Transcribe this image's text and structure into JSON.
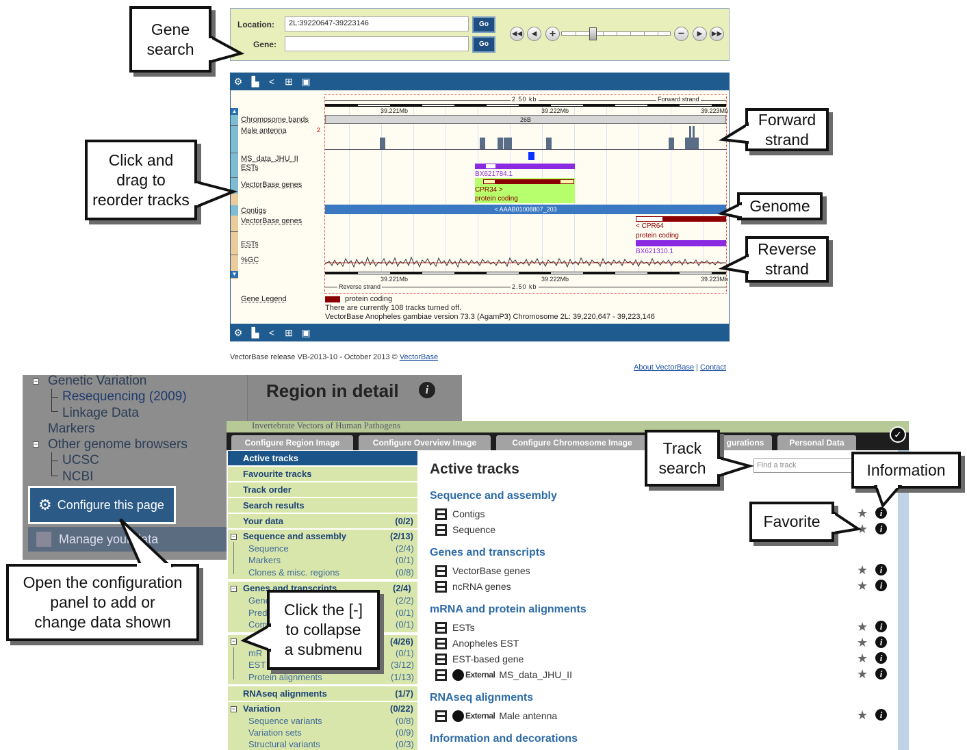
{
  "callouts": {
    "gene_search": "Gene\nsearch",
    "click_drag": "Click and\ndrag to\nreorder tracks",
    "forward_strand": "Forward\nstrand",
    "genome": "Genome",
    "reverse_strand": "Reverse\nstrand",
    "open_config": "Open the configuration\npanel to add or\nchange data shown",
    "collapse": "Click the [-]\nto collapse\na submenu",
    "track_search": "Track\nsearch",
    "information": "Information",
    "favorite": "Favorite"
  },
  "search": {
    "location_label": "Location:",
    "location_value": "2L:39220647-39223146",
    "gene_label": "Gene:",
    "gene_value": "",
    "go_label": "Go",
    "nav_icons": [
      "rewind-icon",
      "step-back-icon",
      "zoom-in-icon",
      "zoom-out-icon",
      "step-forward-icon",
      "fast-forward-icon"
    ]
  },
  "region": {
    "scale_label": "2.50 kb",
    "forward_strand_label": "Forward strand",
    "reverse_strand_label": "Reverse strand",
    "ticks": [
      "39.221Mb",
      "39.222Mb",
      "39.223Mb"
    ],
    "band_label": "26B",
    "male_antenna_count": "2",
    "tracks": {
      "chromosome_bands": "Chromosome bands",
      "male_antenna": "Male antenna",
      "ms_data": "MS_data_JHU_II",
      "ests_fwd": "ESTs",
      "genes_fwd": "VectorBase genes",
      "contigs": "Contigs",
      "genes_rev": "VectorBase genes",
      "ests_rev": "ESTs",
      "gc": "%GC",
      "legend": "Gene Legend"
    },
    "features": {
      "est_fwd": "BX621784.1",
      "gene_fwd_name": "CPR34 >",
      "gene_fwd_type": "protein coding",
      "contig": "< AAAB01008807_203",
      "gene_rev_name": "< CPR64",
      "gene_rev_type": "protein coding",
      "est_rev": "BX621310.1"
    },
    "legend_item": "protein coding",
    "note_tracks_off": "There are currently 108 tracks turned off.",
    "note_version": "VectorBase Anopheles gambiae version 73.3 (AgamP3) Chromosome 2L: 39,220,647 - 39,223,146",
    "toolbar_icons": [
      "gear-icon",
      "export-icon",
      "share-icon",
      "resize-icon",
      "image-icon"
    ]
  },
  "footer": {
    "release_text": "VectorBase release VB-2013-10 - October 2013 © ",
    "release_link": "VectorBase",
    "about": "About VectorBase",
    "contact": "Contact"
  },
  "left_shot": {
    "genetic_variation": "Genetic Variation",
    "resequencing": "Resequencing (2009)",
    "linkage": "Linkage Data",
    "markers": "Markers",
    "other_browsers": "Other genome browsers",
    "ucsc": "UCSC",
    "ncbi": "NCBI",
    "region_title": "Region in detail",
    "configure": "Configure this page",
    "manage": "Manage your data"
  },
  "config": {
    "banner": "Invertebrate Vectors of Human Pathogens",
    "tabs": [
      "Configure Region Image",
      "Configure Overview Image",
      "Configure Chromosome Image",
      "gurations",
      "Personal Data"
    ],
    "menu": {
      "active_tracks": "Active tracks",
      "favourite_tracks": "Favourite tracks",
      "track_order": "Track order",
      "search_results": "Search results",
      "your_data": "Your data",
      "your_data_count": "(0/2)",
      "seq_assembly": "Sequence and assembly",
      "seq_assembly_count": "(2/13)",
      "sequence": "Sequence",
      "sequence_count": "(2/4)",
      "markers": "Markers",
      "markers_count": "(0/1)",
      "clones": "Clones & misc. regions",
      "clones_count": "(0/8)",
      "genes_transcripts": "Genes and transcripts",
      "genes_transcripts_count": "(2/4)",
      "genes_sub1": "Gene",
      "genes_sub1_count": "(2/2)",
      "genes_sub2": "Pred",
      "genes_sub2_count": "(0/1)",
      "genes_sub3": "Com",
      "genes_sub3_count": "(0/1)",
      "mrna_count": "(4/26)",
      "mrna_sub1": "mR",
      "mrna_sub1_count": "(0/1)",
      "mrna_sub2": "EST",
      "mrna_sub2_count": "(3/12)",
      "protein_alignments": "Protein alignments",
      "protein_alignments_count": "(1/13)",
      "rnaseq": "RNAseq alignments",
      "rnaseq_count": "(1/7)",
      "variation": "Variation",
      "variation_count": "(0/22)",
      "seq_variants": "Sequence variants",
      "seq_variants_count": "(0/8)",
      "variation_sets": "Variation sets",
      "variation_sets_count": "(0/9)",
      "structural_variants": "Structural variants",
      "structural_variants_count": "(0/3)"
    },
    "content": {
      "title": "Active tracks",
      "find_placeholder": "Find a track",
      "sections": {
        "seq_assembly": "Sequence and assembly",
        "genes": "Genes and transcripts",
        "mrna": "mRNA and protein alignments",
        "rnaseq": "RNAseq alignments",
        "info": "Information and decorations"
      },
      "tracks": {
        "contigs": "Contigs",
        "sequence": "Sequence",
        "vb_genes": "VectorBase genes",
        "ncrna": "ncRNA genes",
        "ests": "ESTs",
        "anopheles_est": "Anopheles EST",
        "est_based_gene": "EST-based gene",
        "ms_data": "MS_data_JHU_II",
        "male_antenna": "Male antenna"
      },
      "external_label": "External"
    }
  },
  "colors": {
    "search_bg": "#e8efbb",
    "toolbar_blue": "#1f5b8f",
    "gene_red": "#8b0000",
    "est_purple": "#8a2be2",
    "contig_blue": "#3a78c2",
    "menu_green": "#d9e6ab",
    "menu_active": "#1a5488",
    "section_blue": "#2d6aa5"
  }
}
